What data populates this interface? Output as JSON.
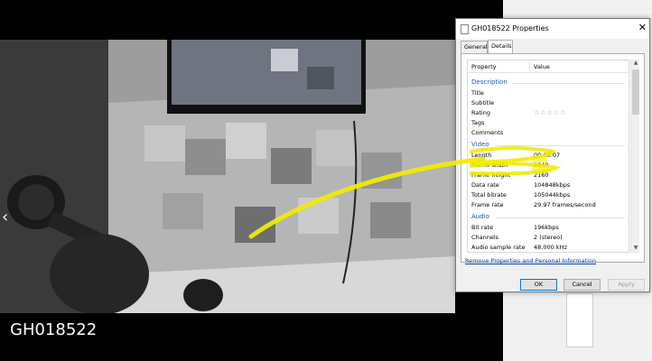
{
  "viewer": {
    "caption": "GH018522",
    "prev_glyph": "‹"
  },
  "dialog": {
    "title": "GH018522 Properties",
    "close_glyph": "✕",
    "tabs": [
      {
        "label": "General",
        "active": false
      },
      {
        "label": "Details",
        "active": true
      }
    ],
    "columns": {
      "property": "Property",
      "value": "Value"
    },
    "sections": {
      "description": "Description",
      "video": "Video",
      "audio": "Audio"
    },
    "description_rows": [
      {
        "key": "Title",
        "value": ""
      },
      {
        "key": "Subtitle",
        "value": ""
      },
      {
        "key": "Rating",
        "value": "☆☆☆☆☆"
      },
      {
        "key": "Tags",
        "value": ""
      },
      {
        "key": "Comments",
        "value": ""
      }
    ],
    "video_rows": [
      {
        "key": "Length",
        "value": "00:00:07"
      },
      {
        "key": "Frame width",
        "value": "3840"
      },
      {
        "key": "Frame height",
        "value": "2160"
      },
      {
        "key": "Data rate",
        "value": "104848kbps"
      },
      {
        "key": "Total bitrate",
        "value": "105044kbps"
      },
      {
        "key": "Frame rate",
        "value": "29.97 frames/second"
      }
    ],
    "audio_rows": [
      {
        "key": "Bit rate",
        "value": "196kbps"
      },
      {
        "key": "Channels",
        "value": "2 (stereo)"
      },
      {
        "key": "Audio sample rate",
        "value": "48.000 kHz"
      }
    ],
    "remove_link": "Remove Properties and Personal Information",
    "buttons": {
      "ok": "OK",
      "cancel": "Cancel",
      "apply": "Apply"
    },
    "scroll_up_glyph": "▲",
    "scroll_down_glyph": "▼"
  },
  "colors": {
    "highlight": "#f2ea00",
    "link": "#0645ad",
    "section": "#1e5aa8"
  }
}
